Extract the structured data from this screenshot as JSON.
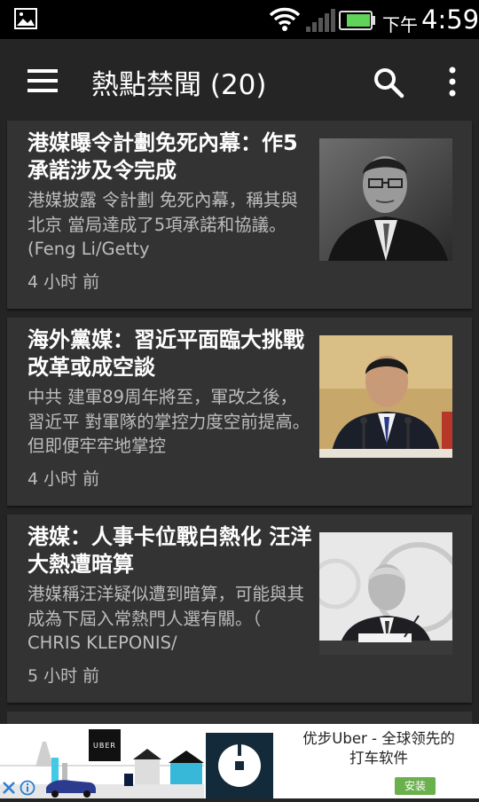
{
  "status_bar": {
    "ampm": "下午",
    "time": "4:59",
    "icons": [
      "gallery-icon",
      "wifi-icon",
      "signal-icon",
      "battery-icon"
    ],
    "battery_color": "#5fd35a"
  },
  "app_bar": {
    "title": "熱點禁聞 (20)",
    "icons": [
      "menu-icon",
      "search-icon",
      "overflow-icon"
    ]
  },
  "articles": [
    {
      "headline": "港媒曝令計劃免死內幕：作5承諾涉及令完成",
      "summary": "港媒披露 令計劃 免死內幕，稱其與 北京 當局達成了5項承諾和協議。 (Feng Li/Getty",
      "time": "4 小时 前"
    },
    {
      "headline": "海外黨媒：習近平面臨大挑戰 改革或成空談",
      "summary": "中共 建軍89周年將至，軍改之後， 習近平 對軍隊的掌控力度空前提高。但即便牢牢地掌控",
      "time": "4 小时 前"
    },
    {
      "headline": "港媒：人事卡位戰白熱化 汪洋大熱遭暗算",
      "summary": "港媒稱汪洋疑似遭到暗算，可能與其成為下屆入常熱門人選有關。（ CHRIS KLEPONIS/",
      "time": "5 小时 前"
    }
  ],
  "ad": {
    "brand": "UBER",
    "text_line1": "优步Uber - 全球领先的",
    "text_line2": "打车软件",
    "install_label": "安装",
    "icons": [
      "close-icon",
      "info-icon"
    ],
    "accent": "#6ab04c"
  },
  "colors": {
    "background": "#242424",
    "card": "#333333",
    "status_bar": "#000000",
    "text_primary": "#ffffff",
    "text_secondary": "#bdbdbd"
  }
}
